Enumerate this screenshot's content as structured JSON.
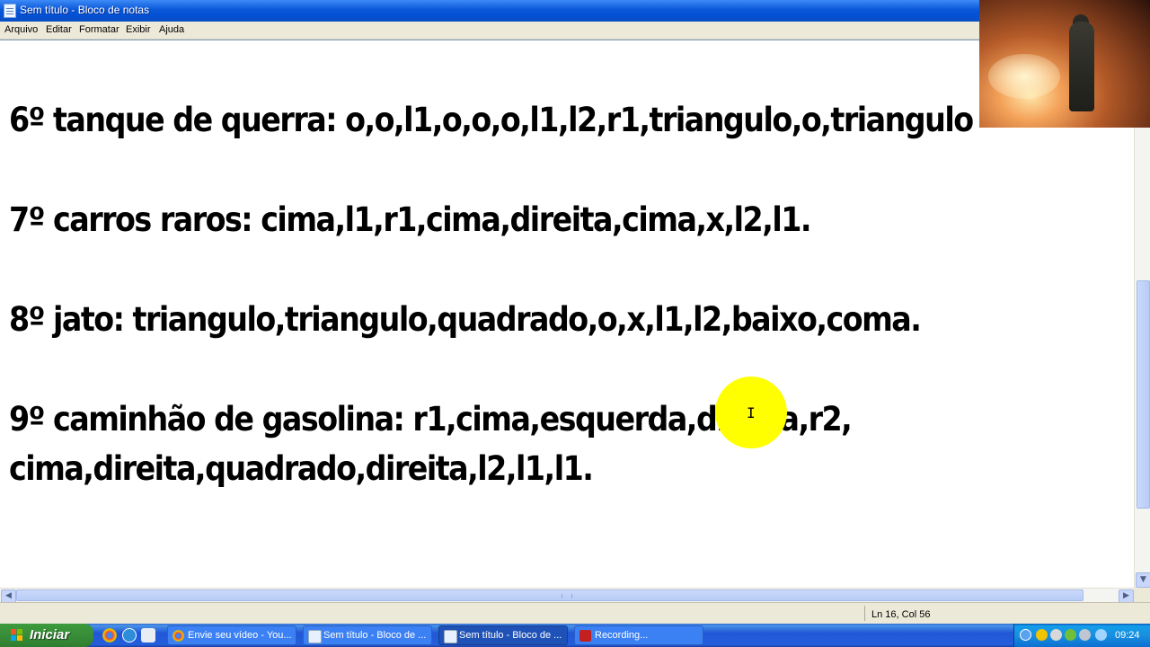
{
  "window": {
    "title": "Sem título - Bloco de notas"
  },
  "menu": [
    "Arquivo",
    "Editar",
    "Formatar",
    "Exibir",
    "Ajuda"
  ],
  "document": {
    "lines": [
      "6º tanque de querra: o,o,l1,o,o,o,l1,l2,r1,triangulo,o,triangulo",
      "7º carros raros: cima,l1,r1,cima,direita,cima,x,l2,l1.",
      "8º jato: triangulo,triangulo,quadrado,o,x,l1,l2,baixo,coma.",
      "9º caminhão de gasolina: r1,cima,esquerda,direita,r2,",
      "cima,direita,quadrado,direita,l2,l1,l1."
    ]
  },
  "status": {
    "position": "Ln 16, Col 56"
  },
  "taskbar": {
    "start_label": "Iniciar",
    "tasks": [
      {
        "label": "Envie seu vídeo - You...",
        "icon": "chrome-icon"
      },
      {
        "label": "Sem título - Bloco de ...",
        "icon": "notepad-icon"
      },
      {
        "label": "Sem título - Bloco de ...",
        "icon": "notepad-icon",
        "active": true
      },
      {
        "label": "Recording...",
        "icon": "recording-icon"
      }
    ],
    "clock": "09:24"
  },
  "colors": {
    "titlebar": "#0a58d8",
    "menubar": "#ece9d8",
    "taskbar": "#245edb",
    "start": "#388e38",
    "cursor_highlight": "#ffff00"
  }
}
